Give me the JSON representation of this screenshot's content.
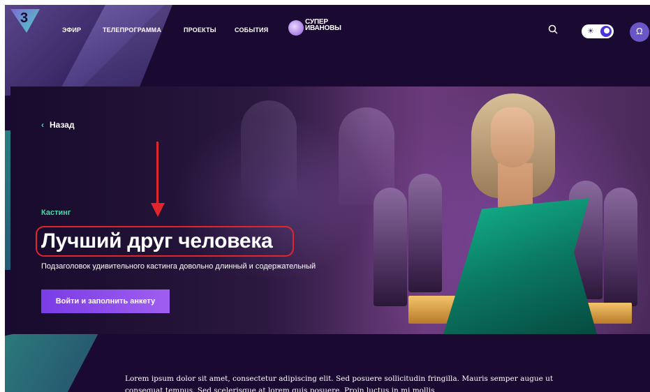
{
  "nav": {
    "logo": "3",
    "items": [
      "ЭФИР",
      "ТЕЛЕПРОГРАММА",
      "ПРОЕКТЫ",
      "СОБЫТИЯ"
    ],
    "brand_line1": "СУПЕР",
    "brand_line2": "ИВАНОВЫ",
    "search_icon": "search-icon",
    "theme_sun": "☀",
    "avatar_glyph": "Ω"
  },
  "hero": {
    "back_chevron": "‹",
    "back_label": "Назад",
    "tag": "Кастинг",
    "title": "Лучший друг человека",
    "subtitle": "Подзаголовок удивительного кастинга довольно длинный и содержательный",
    "cta_label": "Войти и заполнить анкету"
  },
  "body": {
    "text": "Lorem ipsum dolor sit amet, consectetur adipiscing elit. Sed posuere sollicitudin fringilla. Mauris semper augue ut consequat tempus. Sed scelerisque at lorem quis posuere. Proin luctus in mi mollis"
  },
  "colors": {
    "background": "#1a0a32",
    "accent_green": "#4fd8a8",
    "cta_purple": "#7a3ce6",
    "annotation_red": "#e0262c"
  }
}
